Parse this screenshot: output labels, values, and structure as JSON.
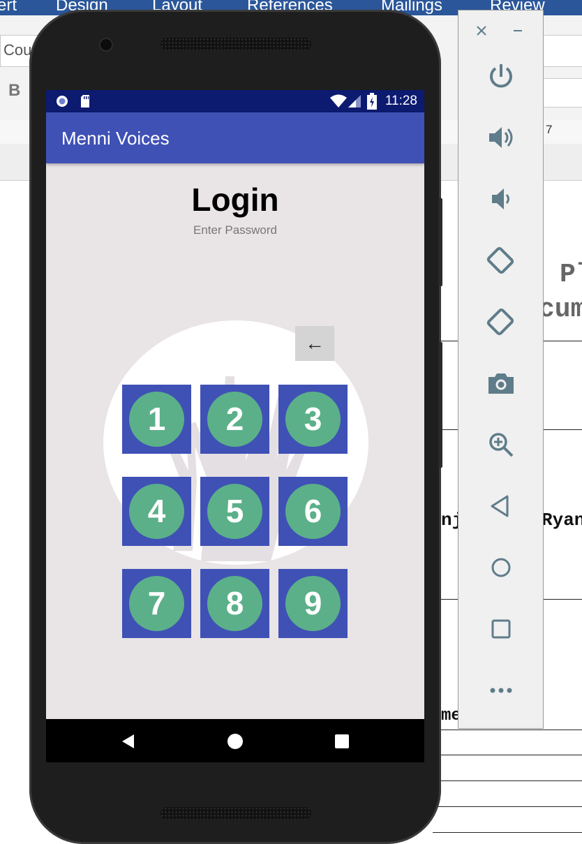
{
  "word": {
    "tabs": [
      "ert",
      "Design",
      "Layout",
      "References",
      "Mailings",
      "Review"
    ],
    "font_box": "Cou",
    "bold": "B",
    "ruler_num": "7",
    "doc_fragments": [
      "Pl",
      "cum",
      "nj",
      "Ryan",
      "me"
    ]
  },
  "status_bar": {
    "time": "11:28"
  },
  "app": {
    "title": "Menni Voices"
  },
  "login": {
    "title": "Login",
    "subtitle": "Enter Password",
    "backspace_icon": "←",
    "keys": [
      "1",
      "2",
      "3",
      "4",
      "5",
      "6",
      "7",
      "8",
      "9"
    ]
  },
  "colors": {
    "status_bar": "#0c1a70",
    "app_bar": "#3f51b5",
    "key_bg": "#3f51b5",
    "key_disc": "#5bb089",
    "screen_bg": "#e9e4e6",
    "toolbar_icon": "#5f7c8a"
  },
  "emulator_toolbar": {
    "window_controls": [
      "close-icon",
      "minimize-icon"
    ],
    "buttons": [
      "power-icon",
      "volume-up-icon",
      "volume-down-icon",
      "rotate-left-icon",
      "rotate-right-icon",
      "camera-icon",
      "zoom-icon",
      "back-icon",
      "home-icon",
      "overview-icon",
      "more-icon"
    ]
  }
}
